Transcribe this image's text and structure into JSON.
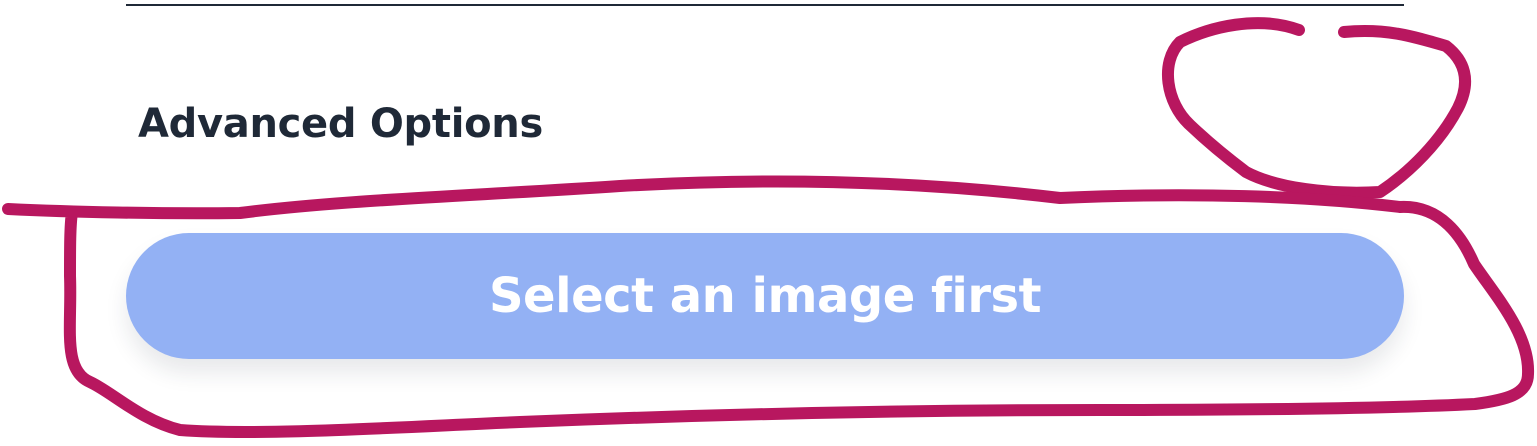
{
  "section": {
    "title": "Advanced Options"
  },
  "action": {
    "label": "Select an image first",
    "enabled": false
  },
  "colors": {
    "title_text": "#1f2937",
    "divider": "#1f2937",
    "button_background": "#93b1f4",
    "button_text": "#ffffff",
    "annotation_stroke": "#b8175f"
  }
}
